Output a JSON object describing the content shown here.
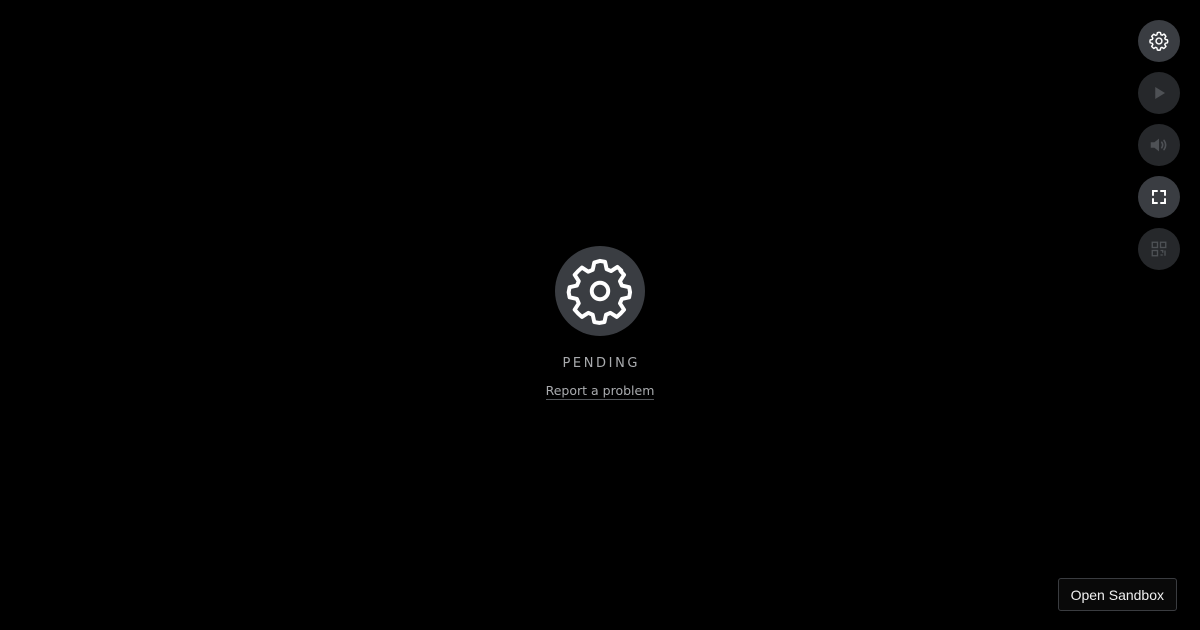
{
  "status": {
    "label": "PENDING",
    "icon": "gear-icon",
    "report_link": "Report a problem"
  },
  "controls": [
    {
      "name": "settings",
      "icon": "gear-icon",
      "enabled": true
    },
    {
      "name": "play",
      "icon": "play-icon",
      "enabled": false
    },
    {
      "name": "volume",
      "icon": "volume-icon",
      "enabled": false
    },
    {
      "name": "fullscreen",
      "icon": "fullscreen-icon",
      "enabled": true
    },
    {
      "name": "qr-code",
      "icon": "qr-code-icon",
      "enabled": false
    }
  ],
  "sandbox": {
    "label": "Open Sandbox"
  },
  "colors": {
    "background": "#000000",
    "button": "#3a3d42",
    "text_muted": "#a9abae"
  }
}
